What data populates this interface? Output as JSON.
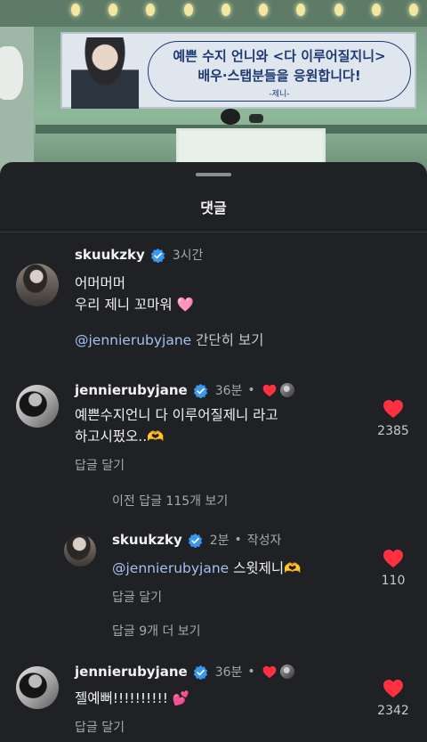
{
  "photo": {
    "banner_line1": "예쁜 수지 언니와 <다 이루어질지니>",
    "banner_line2": "배우·스탭분들을 응원합니다!",
    "banner_sign": "-제니-"
  },
  "sheet": {
    "title": "댓글"
  },
  "comments": [
    {
      "username": "skuukzky",
      "time": "3시간",
      "lines": [
        "어머머머",
        "우리 제니 꼬마워 🩷"
      ],
      "mention": "@jennierubyjane",
      "translate": "간단히 보기"
    },
    {
      "username": "jennierubyjane",
      "time": "36분",
      "sep": "•",
      "lines": [
        "예쁜수지언니 다 이루어질제니 라고",
        "하고시펐오..🫶"
      ],
      "reply": "답글 달기",
      "likes": "2385",
      "more": "이전 답글 115개 보기"
    },
    {
      "username": "skuukzky",
      "time": "2분",
      "sep": "•",
      "author_tag": "작성자",
      "mention": "@jennierubyjane",
      "text": "스윗제니🫶",
      "reply": "답글 달기",
      "likes": "110",
      "more": "답글 9개 더 보기"
    },
    {
      "username": "jennierubyjane",
      "time": "36분",
      "sep": "•",
      "text": "젤예뻐!!!!!!!!!! 💕",
      "reply": "답글 달기",
      "likes": "2342"
    }
  ],
  "colors": {
    "accent_heart": "#ff3040",
    "verified": "#3897f0",
    "mention": "#a3c1f2"
  },
  "icons": {
    "verified": "verified-badge-icon",
    "like": "heart-icon",
    "handle": "drag-handle"
  }
}
